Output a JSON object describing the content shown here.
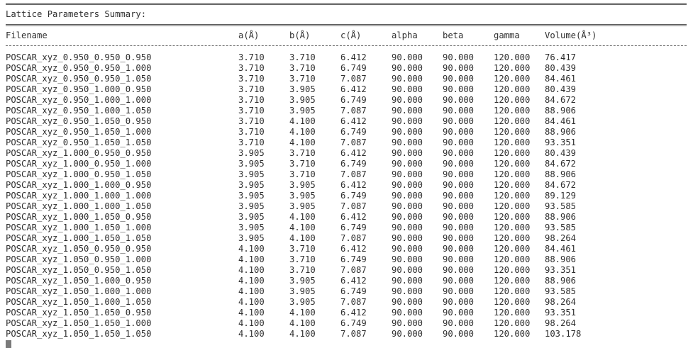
{
  "rule_top": "================================================================================================================================",
  "title": "Lattice Parameters Summary:",
  "rule_header": "================================================================================================================================",
  "rule_sub": "--------------------------------------------------------------------------------------------------------------------------------",
  "columns": [
    "Filename",
    "a(Å)",
    "b(Å)",
    "c(Å)",
    "alpha",
    "beta",
    "gamma",
    "Volume(Å³)"
  ],
  "rows": [
    [
      "POSCAR_xyz_0.950_0.950_0.950",
      "3.710",
      "3.710",
      "6.412",
      "90.000",
      "90.000",
      "120.000",
      "76.417"
    ],
    [
      "POSCAR_xyz_0.950_0.950_1.000",
      "3.710",
      "3.710",
      "6.749",
      "90.000",
      "90.000",
      "120.000",
      "80.439"
    ],
    [
      "POSCAR_xyz_0.950_0.950_1.050",
      "3.710",
      "3.710",
      "7.087",
      "90.000",
      "90.000",
      "120.000",
      "84.461"
    ],
    [
      "POSCAR_xyz_0.950_1.000_0.950",
      "3.710",
      "3.905",
      "6.412",
      "90.000",
      "90.000",
      "120.000",
      "80.439"
    ],
    [
      "POSCAR_xyz_0.950_1.000_1.000",
      "3.710",
      "3.905",
      "6.749",
      "90.000",
      "90.000",
      "120.000",
      "84.672"
    ],
    [
      "POSCAR_xyz_0.950_1.000_1.050",
      "3.710",
      "3.905",
      "7.087",
      "90.000",
      "90.000",
      "120.000",
      "88.906"
    ],
    [
      "POSCAR_xyz_0.950_1.050_0.950",
      "3.710",
      "4.100",
      "6.412",
      "90.000",
      "90.000",
      "120.000",
      "84.461"
    ],
    [
      "POSCAR_xyz_0.950_1.050_1.000",
      "3.710",
      "4.100",
      "6.749",
      "90.000",
      "90.000",
      "120.000",
      "88.906"
    ],
    [
      "POSCAR_xyz_0.950_1.050_1.050",
      "3.710",
      "4.100",
      "7.087",
      "90.000",
      "90.000",
      "120.000",
      "93.351"
    ],
    [
      "POSCAR_xyz_1.000_0.950_0.950",
      "3.905",
      "3.710",
      "6.412",
      "90.000",
      "90.000",
      "120.000",
      "80.439"
    ],
    [
      "POSCAR_xyz_1.000_0.950_1.000",
      "3.905",
      "3.710",
      "6.749",
      "90.000",
      "90.000",
      "120.000",
      "84.672"
    ],
    [
      "POSCAR_xyz_1.000_0.950_1.050",
      "3.905",
      "3.710",
      "7.087",
      "90.000",
      "90.000",
      "120.000",
      "88.906"
    ],
    [
      "POSCAR_xyz_1.000_1.000_0.950",
      "3.905",
      "3.905",
      "6.412",
      "90.000",
      "90.000",
      "120.000",
      "84.672"
    ],
    [
      "POSCAR_xyz_1.000_1.000_1.000",
      "3.905",
      "3.905",
      "6.749",
      "90.000",
      "90.000",
      "120.000",
      "89.129"
    ],
    [
      "POSCAR_xyz_1.000_1.000_1.050",
      "3.905",
      "3.905",
      "7.087",
      "90.000",
      "90.000",
      "120.000",
      "93.585"
    ],
    [
      "POSCAR_xyz_1.000_1.050_0.950",
      "3.905",
      "4.100",
      "6.412",
      "90.000",
      "90.000",
      "120.000",
      "88.906"
    ],
    [
      "POSCAR_xyz_1.000_1.050_1.000",
      "3.905",
      "4.100",
      "6.749",
      "90.000",
      "90.000",
      "120.000",
      "93.585"
    ],
    [
      "POSCAR_xyz_1.000_1.050_1.050",
      "3.905",
      "4.100",
      "7.087",
      "90.000",
      "90.000",
      "120.000",
      "98.264"
    ],
    [
      "POSCAR_xyz_1.050_0.950_0.950",
      "4.100",
      "3.710",
      "6.412",
      "90.000",
      "90.000",
      "120.000",
      "84.461"
    ],
    [
      "POSCAR_xyz_1.050_0.950_1.000",
      "4.100",
      "3.710",
      "6.749",
      "90.000",
      "90.000",
      "120.000",
      "88.906"
    ],
    [
      "POSCAR_xyz_1.050_0.950_1.050",
      "4.100",
      "3.710",
      "7.087",
      "90.000",
      "90.000",
      "120.000",
      "93.351"
    ],
    [
      "POSCAR_xyz_1.050_1.000_0.950",
      "4.100",
      "3.905",
      "6.412",
      "90.000",
      "90.000",
      "120.000",
      "88.906"
    ],
    [
      "POSCAR_xyz_1.050_1.000_1.000",
      "4.100",
      "3.905",
      "6.749",
      "90.000",
      "90.000",
      "120.000",
      "93.585"
    ],
    [
      "POSCAR_xyz_1.050_1.000_1.050",
      "4.100",
      "3.905",
      "7.087",
      "90.000",
      "90.000",
      "120.000",
      "98.264"
    ],
    [
      "POSCAR_xyz_1.050_1.050_0.950",
      "4.100",
      "4.100",
      "6.412",
      "90.000",
      "90.000",
      "120.000",
      "93.351"
    ],
    [
      "POSCAR_xyz_1.050_1.050_1.000",
      "4.100",
      "4.100",
      "6.749",
      "90.000",
      "90.000",
      "120.000",
      "98.264"
    ],
    [
      "POSCAR_xyz_1.050_1.050_1.050",
      "4.100",
      "4.100",
      "7.087",
      "90.000",
      "90.000",
      "120.000",
      "103.178"
    ]
  ]
}
